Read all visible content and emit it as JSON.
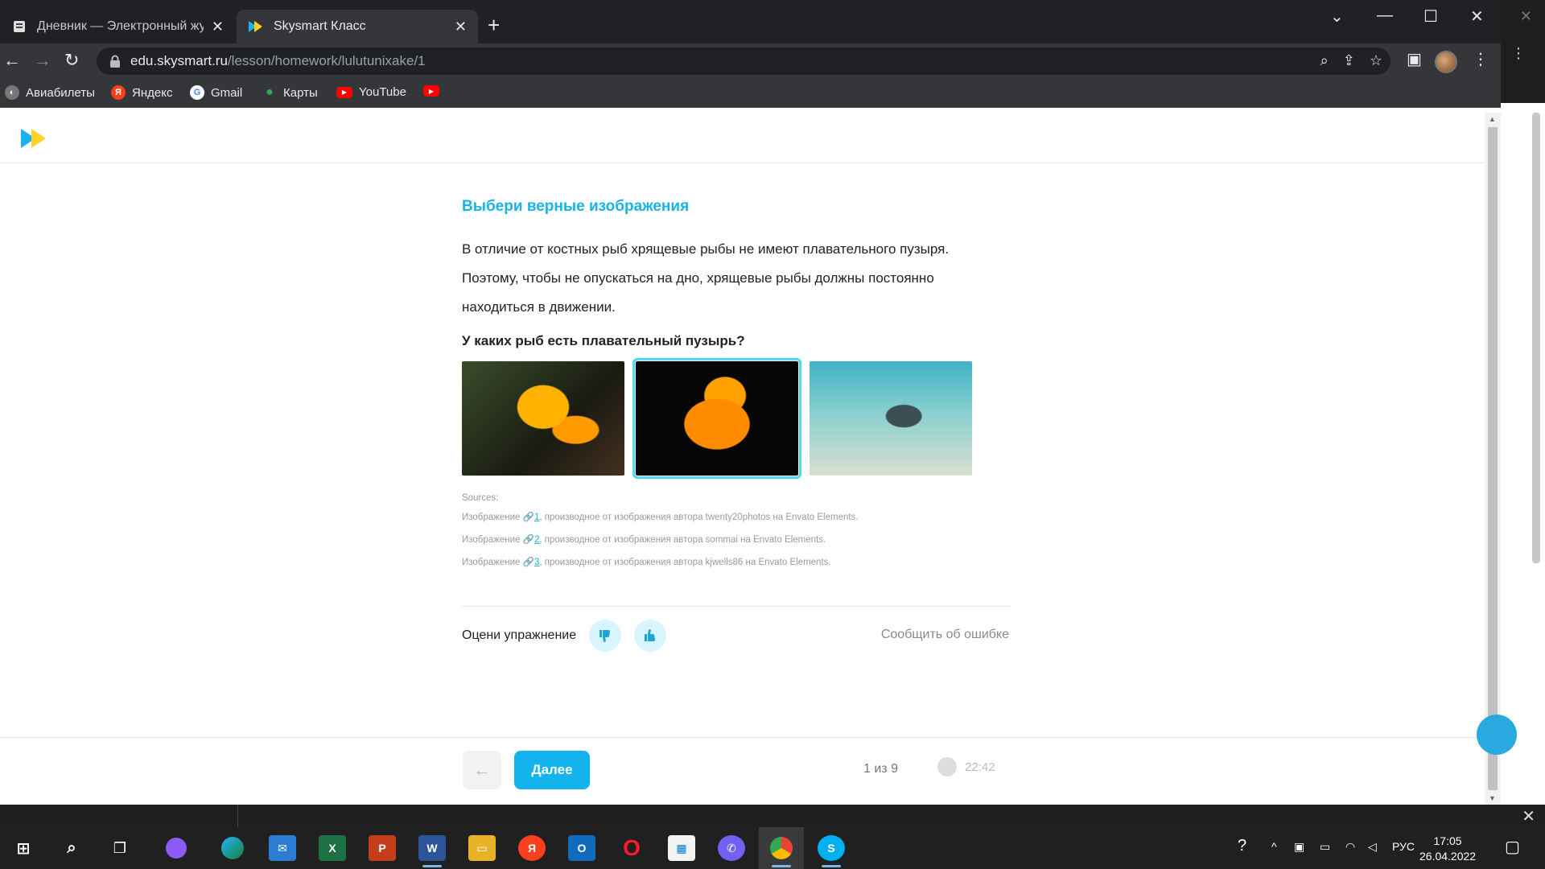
{
  "browser": {
    "tabs": [
      {
        "label": "Дневник — Электронный журн",
        "active": false
      },
      {
        "label": "Skysmart Класс",
        "active": true
      }
    ],
    "url_host": "edu.skysmart.ru",
    "url_path": "/lesson/homework/lulutunixake/1",
    "bookmarks": [
      "Авиабилеты",
      "Яндекс",
      "Gmail",
      "Карты",
      "YouTube"
    ]
  },
  "exercise": {
    "title": "Выбери верные изображения",
    "text_lines": [
      "В отличие от костных рыб хрящевые рыбы не имеют плавательного пузыря.",
      "Поэтому, чтобы не опускаться на дно, хрящевые рыбы должны постоянно",
      "находиться в движении."
    ],
    "question": "У каких рыб есть плавательный пузырь?",
    "images": [
      {
        "id": "goldfish",
        "selected": false
      },
      {
        "id": "orange-fish",
        "selected": true
      },
      {
        "id": "stingray",
        "selected": false
      }
    ],
    "sources_heading": "Sources:",
    "sources": [
      {
        "prefix": "Изображение",
        "num": "1",
        "suffix": ", производное от изображения автора twenty20photos на Envato Elements."
      },
      {
        "prefix": "Изображение",
        "num": "2",
        "suffix": ", производное от изображения автора sommai на Envato Elements."
      },
      {
        "prefix": "Изображение",
        "num": "3",
        "suffix": ", производное от изображения автора kjwells86 на Envato Elements."
      }
    ],
    "rate_label": "Оцени упражнение",
    "report_label": "Сообщить об ошибке"
  },
  "footer": {
    "next_label": "Далее",
    "progress": "1 из 9",
    "timer": "22:42"
  },
  "taskbar": {
    "lang": "РУС",
    "time": "17:05",
    "date": "26.04.2022"
  },
  "colors": {
    "accent": "#13b3ee",
    "title_blue": "#19b3e6",
    "selection": "#4fd6f3"
  }
}
